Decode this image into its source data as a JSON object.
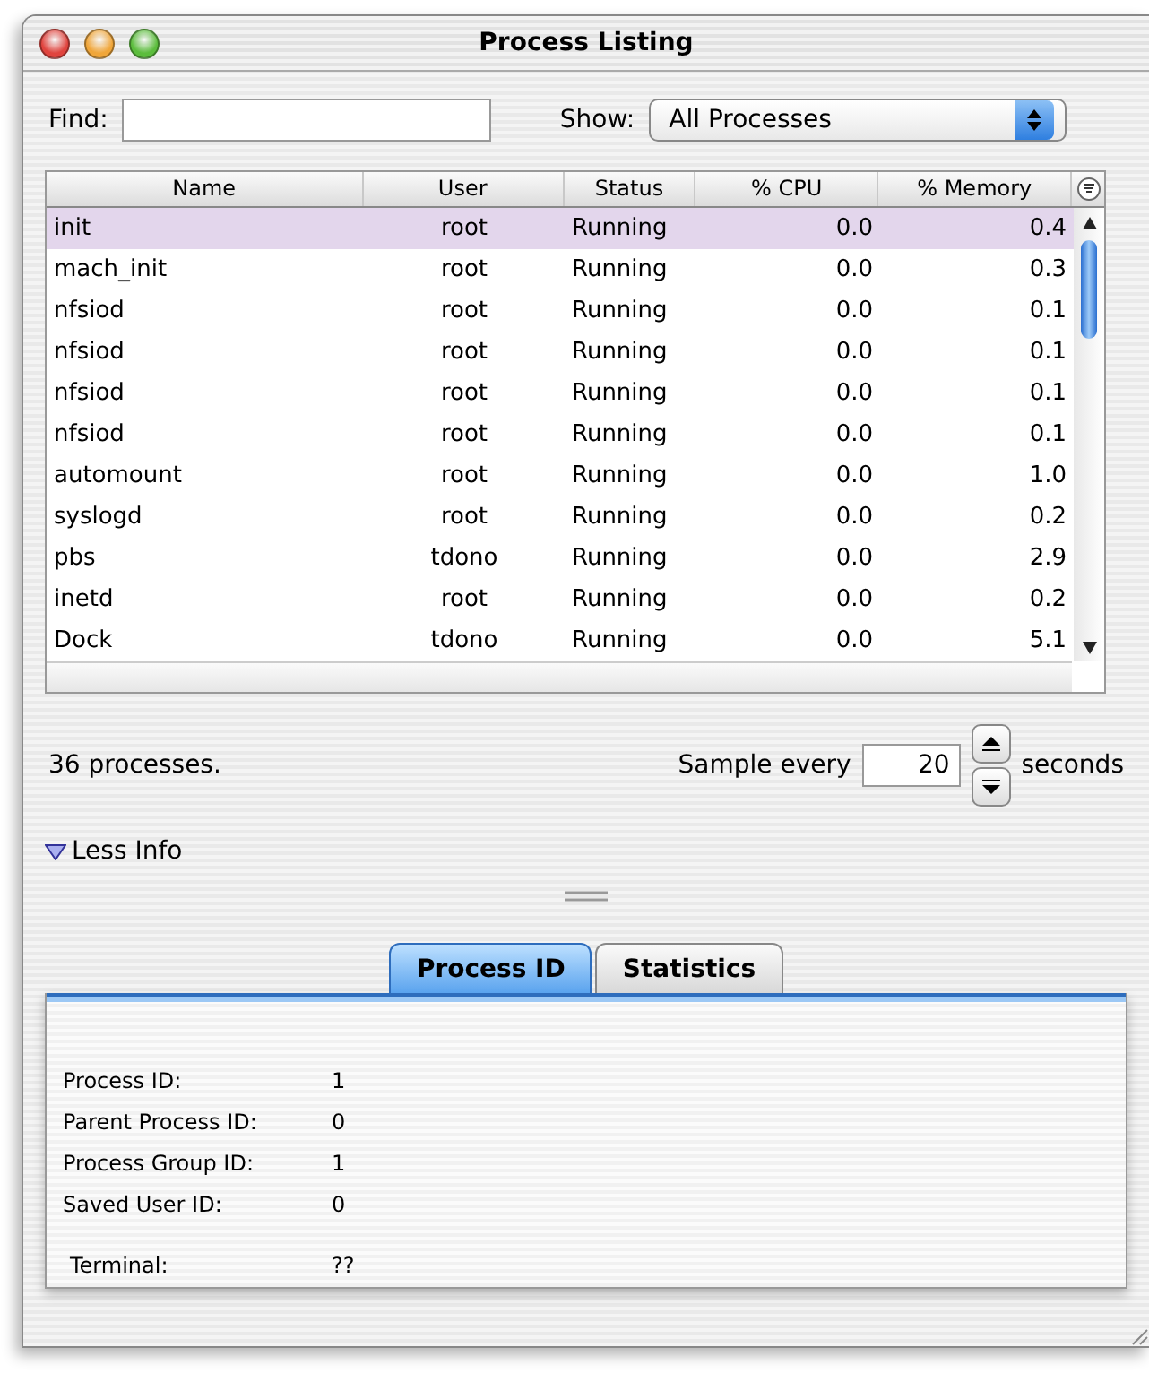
{
  "window": {
    "title": "Process Listing"
  },
  "find": {
    "label": "Find:"
  },
  "show": {
    "label": "Show:",
    "value": "All Processes"
  },
  "table": {
    "columns": [
      "Name",
      "User",
      "Status",
      "% CPU",
      "% Memory"
    ],
    "rows": [
      {
        "cells": [
          "init",
          "root",
          "Running",
          "0.0",
          "0.4"
        ],
        "selected": true
      },
      {
        "cells": [
          "mach_init",
          "root",
          "Running",
          "0.0",
          "0.3"
        ],
        "selected": false
      },
      {
        "cells": [
          "nfsiod",
          "root",
          "Running",
          "0.0",
          "0.1"
        ],
        "selected": false
      },
      {
        "cells": [
          "nfsiod",
          "root",
          "Running",
          "0.0",
          "0.1"
        ],
        "selected": false
      },
      {
        "cells": [
          "nfsiod",
          "root",
          "Running",
          "0.0",
          "0.1"
        ],
        "selected": false
      },
      {
        "cells": [
          "nfsiod",
          "root",
          "Running",
          "0.0",
          "0.1"
        ],
        "selected": false
      },
      {
        "cells": [
          "automount",
          "root",
          "Running",
          "0.0",
          "1.0"
        ],
        "selected": false
      },
      {
        "cells": [
          "syslogd",
          "root",
          "Running",
          "0.0",
          "0.2"
        ],
        "selected": false
      },
      {
        "cells": [
          "pbs",
          "tdono",
          "Running",
          "0.0",
          "2.9"
        ],
        "selected": false
      },
      {
        "cells": [
          "inetd",
          "root",
          "Running",
          "0.0",
          "0.2"
        ],
        "selected": false
      },
      {
        "cells": [
          "Dock",
          "tdono",
          "Running",
          "0.0",
          "5.1"
        ],
        "selected": false
      }
    ]
  },
  "status": {
    "count": "36 processes.",
    "sample_label": "Sample every",
    "sample_value": "20",
    "sample_unit": "seconds"
  },
  "disclosure": {
    "label": "Less Info",
    "expanded": true
  },
  "tabs": [
    {
      "label": "Process ID",
      "selected": true
    },
    {
      "label": "Statistics",
      "selected": false
    }
  ],
  "details": [
    {
      "label": "Process ID:",
      "value": "1"
    },
    {
      "label": "Parent Process ID:",
      "value": "0"
    },
    {
      "label": "Process Group ID:",
      "value": "1"
    },
    {
      "label": "Saved User ID:",
      "value": "0"
    },
    {
      "label": "Terminal:",
      "value": "??"
    }
  ]
}
